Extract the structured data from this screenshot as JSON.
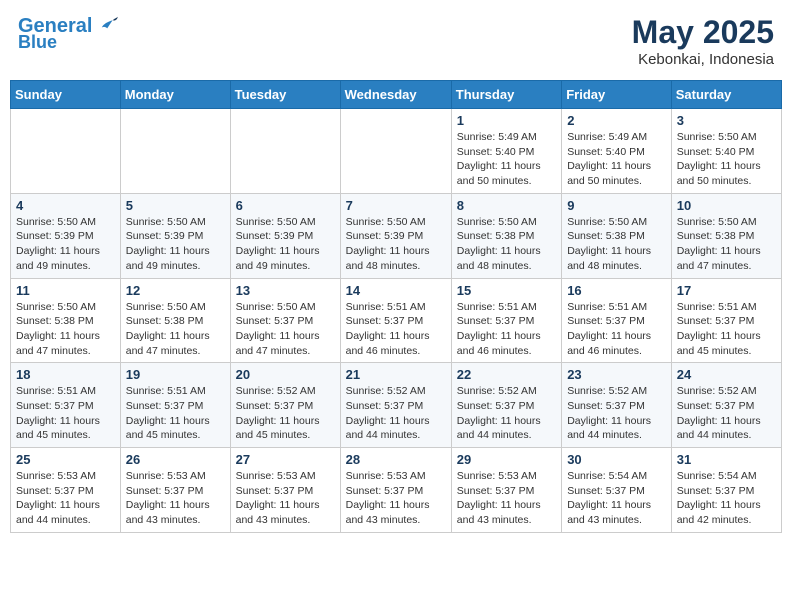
{
  "header": {
    "logo_line1": "General",
    "logo_line2": "Blue",
    "month_year": "May 2025",
    "location": "Kebonkai, Indonesia"
  },
  "weekdays": [
    "Sunday",
    "Monday",
    "Tuesday",
    "Wednesday",
    "Thursday",
    "Friday",
    "Saturday"
  ],
  "weeks": [
    [
      {
        "day": "",
        "info": ""
      },
      {
        "day": "",
        "info": ""
      },
      {
        "day": "",
        "info": ""
      },
      {
        "day": "",
        "info": ""
      },
      {
        "day": "1",
        "info": "Sunrise: 5:49 AM\nSunset: 5:40 PM\nDaylight: 11 hours\nand 50 minutes."
      },
      {
        "day": "2",
        "info": "Sunrise: 5:49 AM\nSunset: 5:40 PM\nDaylight: 11 hours\nand 50 minutes."
      },
      {
        "day": "3",
        "info": "Sunrise: 5:50 AM\nSunset: 5:40 PM\nDaylight: 11 hours\nand 50 minutes."
      }
    ],
    [
      {
        "day": "4",
        "info": "Sunrise: 5:50 AM\nSunset: 5:39 PM\nDaylight: 11 hours\nand 49 minutes."
      },
      {
        "day": "5",
        "info": "Sunrise: 5:50 AM\nSunset: 5:39 PM\nDaylight: 11 hours\nand 49 minutes."
      },
      {
        "day": "6",
        "info": "Sunrise: 5:50 AM\nSunset: 5:39 PM\nDaylight: 11 hours\nand 49 minutes."
      },
      {
        "day": "7",
        "info": "Sunrise: 5:50 AM\nSunset: 5:39 PM\nDaylight: 11 hours\nand 48 minutes."
      },
      {
        "day": "8",
        "info": "Sunrise: 5:50 AM\nSunset: 5:38 PM\nDaylight: 11 hours\nand 48 minutes."
      },
      {
        "day": "9",
        "info": "Sunrise: 5:50 AM\nSunset: 5:38 PM\nDaylight: 11 hours\nand 48 minutes."
      },
      {
        "day": "10",
        "info": "Sunrise: 5:50 AM\nSunset: 5:38 PM\nDaylight: 11 hours\nand 47 minutes."
      }
    ],
    [
      {
        "day": "11",
        "info": "Sunrise: 5:50 AM\nSunset: 5:38 PM\nDaylight: 11 hours\nand 47 minutes."
      },
      {
        "day": "12",
        "info": "Sunrise: 5:50 AM\nSunset: 5:38 PM\nDaylight: 11 hours\nand 47 minutes."
      },
      {
        "day": "13",
        "info": "Sunrise: 5:50 AM\nSunset: 5:37 PM\nDaylight: 11 hours\nand 47 minutes."
      },
      {
        "day": "14",
        "info": "Sunrise: 5:51 AM\nSunset: 5:37 PM\nDaylight: 11 hours\nand 46 minutes."
      },
      {
        "day": "15",
        "info": "Sunrise: 5:51 AM\nSunset: 5:37 PM\nDaylight: 11 hours\nand 46 minutes."
      },
      {
        "day": "16",
        "info": "Sunrise: 5:51 AM\nSunset: 5:37 PM\nDaylight: 11 hours\nand 46 minutes."
      },
      {
        "day": "17",
        "info": "Sunrise: 5:51 AM\nSunset: 5:37 PM\nDaylight: 11 hours\nand 45 minutes."
      }
    ],
    [
      {
        "day": "18",
        "info": "Sunrise: 5:51 AM\nSunset: 5:37 PM\nDaylight: 11 hours\nand 45 minutes."
      },
      {
        "day": "19",
        "info": "Sunrise: 5:51 AM\nSunset: 5:37 PM\nDaylight: 11 hours\nand 45 minutes."
      },
      {
        "day": "20",
        "info": "Sunrise: 5:52 AM\nSunset: 5:37 PM\nDaylight: 11 hours\nand 45 minutes."
      },
      {
        "day": "21",
        "info": "Sunrise: 5:52 AM\nSunset: 5:37 PM\nDaylight: 11 hours\nand 44 minutes."
      },
      {
        "day": "22",
        "info": "Sunrise: 5:52 AM\nSunset: 5:37 PM\nDaylight: 11 hours\nand 44 minutes."
      },
      {
        "day": "23",
        "info": "Sunrise: 5:52 AM\nSunset: 5:37 PM\nDaylight: 11 hours\nand 44 minutes."
      },
      {
        "day": "24",
        "info": "Sunrise: 5:52 AM\nSunset: 5:37 PM\nDaylight: 11 hours\nand 44 minutes."
      }
    ],
    [
      {
        "day": "25",
        "info": "Sunrise: 5:53 AM\nSunset: 5:37 PM\nDaylight: 11 hours\nand 44 minutes."
      },
      {
        "day": "26",
        "info": "Sunrise: 5:53 AM\nSunset: 5:37 PM\nDaylight: 11 hours\nand 43 minutes."
      },
      {
        "day": "27",
        "info": "Sunrise: 5:53 AM\nSunset: 5:37 PM\nDaylight: 11 hours\nand 43 minutes."
      },
      {
        "day": "28",
        "info": "Sunrise: 5:53 AM\nSunset: 5:37 PM\nDaylight: 11 hours\nand 43 minutes."
      },
      {
        "day": "29",
        "info": "Sunrise: 5:53 AM\nSunset: 5:37 PM\nDaylight: 11 hours\nand 43 minutes."
      },
      {
        "day": "30",
        "info": "Sunrise: 5:54 AM\nSunset: 5:37 PM\nDaylight: 11 hours\nand 43 minutes."
      },
      {
        "day": "31",
        "info": "Sunrise: 5:54 AM\nSunset: 5:37 PM\nDaylight: 11 hours\nand 42 minutes."
      }
    ]
  ]
}
